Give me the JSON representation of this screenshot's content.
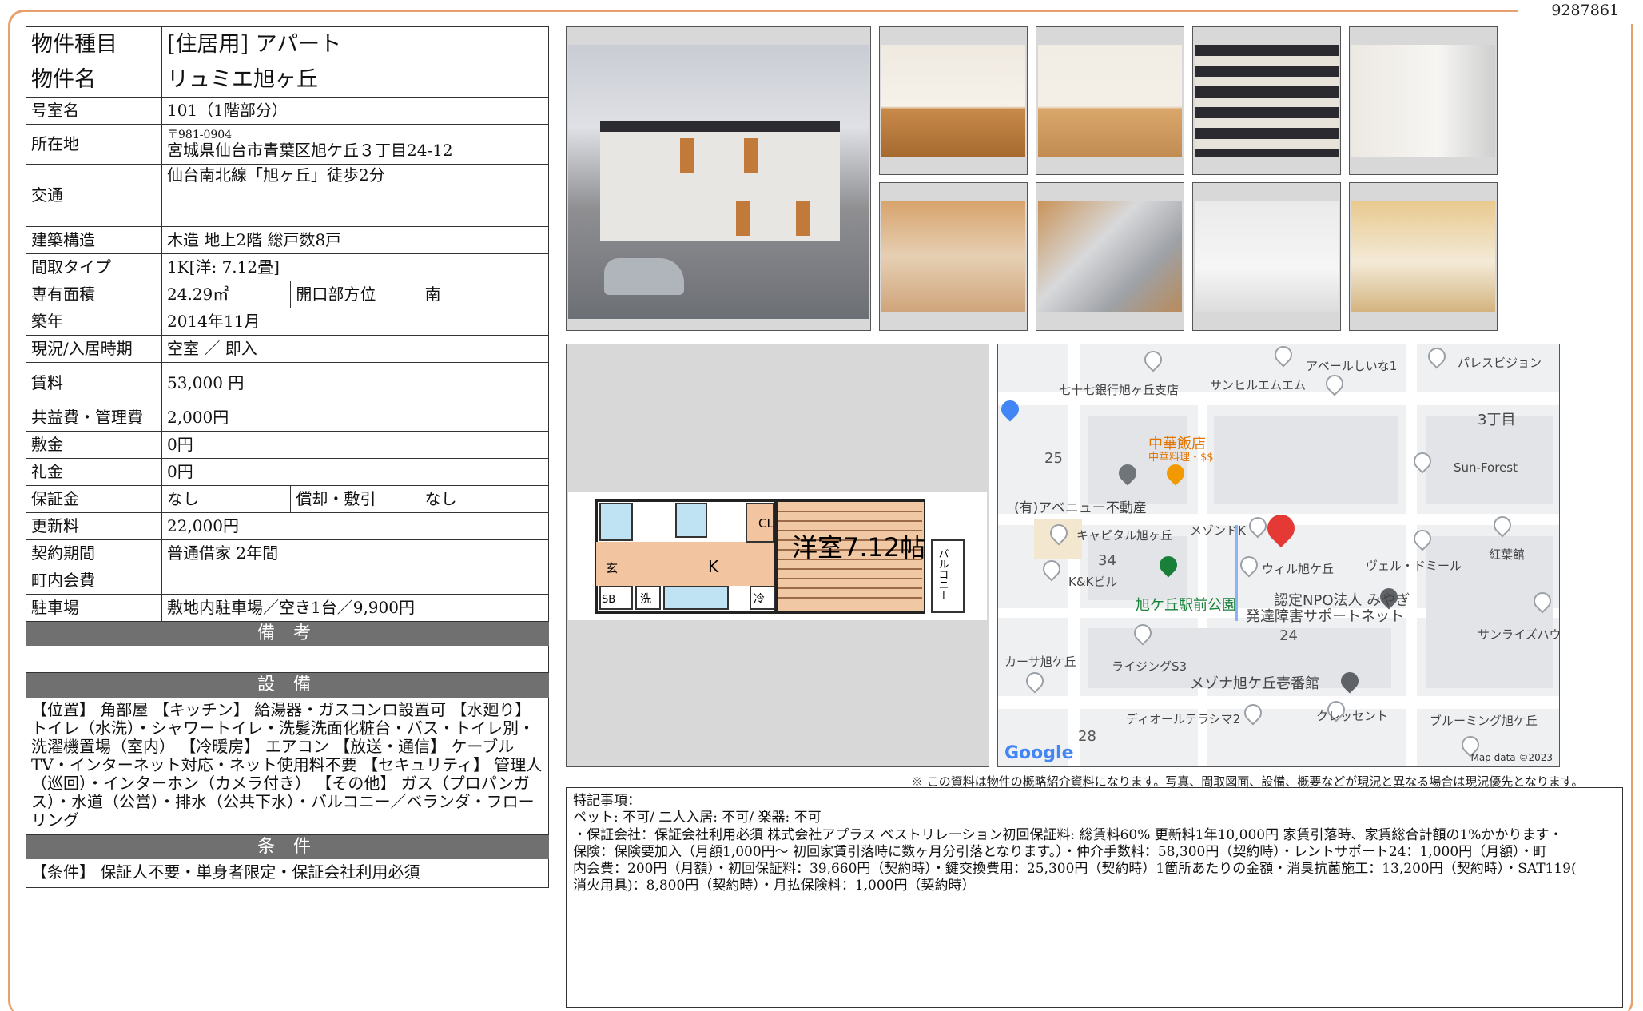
{
  "doc_number": "9287861",
  "rows": {
    "type": {
      "label": "物件種目",
      "value": "[住居用]  アパート"
    },
    "name": {
      "label": "物件名",
      "value": "リュミエ旭ヶ丘"
    },
    "room": {
      "label": "号室名",
      "value": "101（1階部分）"
    },
    "address": {
      "label": "所在地",
      "zip": "〒981-0904",
      "value": "宮城県仙台市青葉区旭ケ丘３丁目24-12"
    },
    "transit": {
      "label": "交通",
      "value": "仙台南北線「旭ヶ丘」徒歩2分"
    },
    "structure": {
      "label": "建築構造",
      "value": "木造  地上2階  総戸数8戸"
    },
    "layout": {
      "label": "間取タイプ",
      "value": "1K[洋: 7.12畳]"
    },
    "area": {
      "label": "専有面積",
      "value": "24.29㎡",
      "label2": "開口部方位",
      "value2": "南"
    },
    "built": {
      "label": "築年",
      "value": "2014年11月"
    },
    "status": {
      "label": "現況/入居時期",
      "value": "空室 ／ 即入"
    },
    "rent": {
      "label": "賃料",
      "value": "53,000 円"
    },
    "fee": {
      "label": "共益費・管理費",
      "value": "2,000円"
    },
    "deposit": {
      "label": "敷金",
      "value": "0円"
    },
    "key_money": {
      "label": "礼金",
      "value": "0円"
    },
    "guarantee": {
      "label": "保証金",
      "value": "なし",
      "label2": "償却・敷引",
      "value2": "なし"
    },
    "renewal": {
      "label": "更新料",
      "value": "22,000円"
    },
    "contract": {
      "label": "契約期間",
      "value": "普通借家  2年間"
    },
    "neighborhood": {
      "label": "町内会費",
      "value": ""
    },
    "parking": {
      "label": "駐車場",
      "value": "敷地内駐車場／空き1台／9,900円"
    }
  },
  "sections": {
    "remarks": {
      "title": "備 考",
      "text": ""
    },
    "equipment": {
      "title": "設 備",
      "text": "【位置】 角部屋 【キッチン】 給湯器・ガスコンロ設置可 【水廻り】 トイレ（水洗）・シャワートイレ・洗髪洗面化粧台・バス・トイレ別・洗濯機置場（室内） 【冷暖房】 エアコン 【放送・通信】 ケーブルTV・インターネット対応・ネット使用料不要 【セキュリティ】 管理人（巡回）・インターホン（カメラ付き） 【その他】 ガス（プロパンガス）・水道（公営）・排水（公共下水）・バルコニー／ベランダ・フローリング"
    },
    "conditions": {
      "title": "条 件",
      "text": "【条件】 保証人不要・単身者限定・保証会社利用必須"
    }
  },
  "floorplan": {
    "room_label": "洋室7.12帖",
    "k": "K",
    "cl": "CL",
    "entrance": "玄",
    "sb": "SB",
    "wash": "洗",
    "fridge": "冷",
    "balcony": "バルコニー"
  },
  "map": {
    "labels": [
      "アベールしいな1",
      "パレスビジョン",
      "七十七銀行旭ヶ丘支店",
      "サンヒルエムエム",
      "3丁目",
      "中華飯店",
      "中華料理・$$",
      "Sun-Forest",
      "(有)アベニュー不動産",
      "キャピタル旭ヶ丘",
      "メゾンドK",
      "紅葉館",
      "K&Kビル",
      "ウィル旭ケ丘",
      "ヴェル・ドミール",
      "旭ケ丘駅前公園",
      "認定NPO法人 みやぎ",
      "発達障害サポートネット",
      "サンライズハウ",
      "カーサ旭ケ丘",
      "ライジングS3",
      "メゾナ旭ケ丘壱番館",
      "ディオールテラシマ2",
      "クレッセント",
      "ブルーミング旭ケ丘"
    ],
    "numbers": [
      "25",
      "34",
      "24",
      "28"
    ],
    "google": "Google",
    "mapdata": "Map data ©2023"
  },
  "disclaimer": "※ この資料は物件の概略紹介資料になります。写真、間取図面、設備、概要などが現況と異なる場合は現況優先となります。",
  "special": {
    "title": "特記事項：",
    "lines": [
      "ペット: 不可/ 二人入居: 不可/ 楽器: 不可",
      "・保証会社：保証会社利用必須 株式会社アプラス ベストリレーション初回保証料: 総賃料60%  更新料1年10,000円  家賃引落時、家賃総合計額の1%かかります・",
      "保険：保険要加入（月額1,000円〜  初回家賃引落時に数ヶ月分引落となります。）・仲介手数料：58,300円（契約時）・レントサポート24：1,000円（月額）・町",
      "内会費：200円（月額）・初回保証料：39,660円（契約時）・鍵交換費用：25,300円（契約時）1箇所あたりの金額・消臭抗菌施工：13,200円（契約時）・SAT119(",
      "消火用具)：8,800円（契約時）・月払保険料：1,000円（契約時）"
    ]
  }
}
